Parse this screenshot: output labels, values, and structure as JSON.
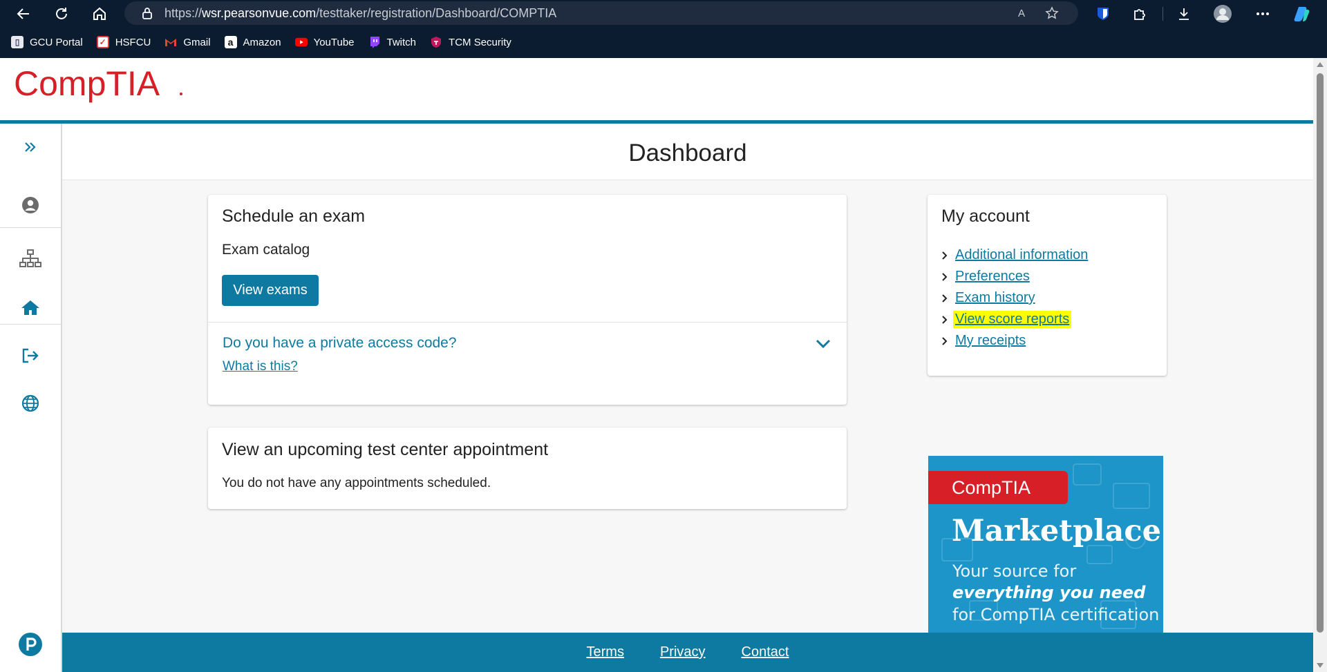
{
  "browser": {
    "url_prefix": "https://",
    "url_domain": "wsr.pearsonvue.com",
    "url_path": "/testtaker/registration/Dashboard/COMPTIA",
    "read_aloud": "A",
    "bookmarks": [
      {
        "label": "GCU Portal",
        "icon": "gcu-portal-icon",
        "color": "#e8e8f0"
      },
      {
        "label": "HSFCU",
        "icon": "hsfcu-icon",
        "color": "#e43b3b"
      },
      {
        "label": "Gmail",
        "icon": "gmail-icon",
        "color": "#ea4335"
      },
      {
        "label": "Amazon",
        "icon": "amazon-icon",
        "color": "#ffffff"
      },
      {
        "label": "YouTube",
        "icon": "youtube-icon",
        "color": "#ff0000"
      },
      {
        "label": "Twitch",
        "icon": "twitch-icon",
        "color": "#9146ff"
      },
      {
        "label": "TCM Security",
        "icon": "tcm-security-icon",
        "color": "#c2185b"
      }
    ]
  },
  "header": {
    "logo_text": "CompTIA"
  },
  "page": {
    "title": "Dashboard"
  },
  "schedule_card": {
    "title": "Schedule an exam",
    "subtitle": "Exam catalog",
    "button": "View exams",
    "access_question": "Do you have a private access code?",
    "access_help": "What is this?"
  },
  "appointment_card": {
    "title": "View an upcoming test center appointment",
    "message": "You do not have any appointments scheduled."
  },
  "account_card": {
    "title": "My account",
    "links": [
      {
        "label": "Additional information",
        "highlighted": false
      },
      {
        "label": "Preferences",
        "highlighted": false
      },
      {
        "label": "Exam history",
        "highlighted": false
      },
      {
        "label": "View score reports",
        "highlighted": true
      },
      {
        "label": "My receipts",
        "highlighted": false
      }
    ]
  },
  "promo": {
    "brand": "CompTIA",
    "headline": "Marketplace",
    "line1": "Your source for",
    "line2": "everything you need",
    "line3": "for CompTIA certification"
  },
  "footer": {
    "links": [
      "Terms",
      "Privacy",
      "Contact"
    ]
  },
  "colors": {
    "brand_teal": "#0e7aa1",
    "comptia_red": "#d71f27",
    "highlight": "#ffff00"
  }
}
